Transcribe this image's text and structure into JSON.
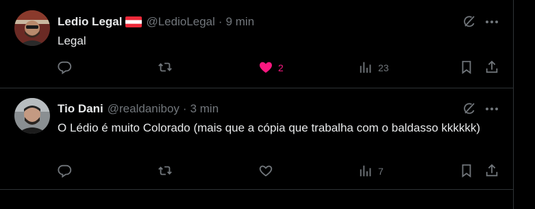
{
  "tweets": [
    {
      "name": "Ledio Legal",
      "handle": "@LedioLegal",
      "separator": "·",
      "time": "9 min",
      "text": "Legal",
      "reply_count": "",
      "retweet_count": "",
      "like_count": "2",
      "liked": true,
      "view_count": "23"
    },
    {
      "name": "Tio Dani",
      "handle": "@realdaniboy",
      "separator": "·",
      "time": "3 min",
      "text": "O Lédio é muito Colorado (mais que a cópia que trabalha com o baldasso kkkkkk)",
      "reply_count": "",
      "retweet_count": "",
      "like_count": "",
      "liked": false,
      "view_count": "7"
    }
  ],
  "icons": {
    "reply": "reply-icon",
    "retweet": "retweet-icon",
    "like": "heart-icon",
    "views": "views-icon",
    "bookmark": "bookmark-icon",
    "share": "share-icon",
    "grok": "grok-icon",
    "more": "more-icon",
    "flag": "austria-flag-icon"
  },
  "colors": {
    "background": "#000000",
    "text": "#e7e9ea",
    "muted": "#71767b",
    "border": "#2f3336",
    "like_active": "#f91880"
  }
}
